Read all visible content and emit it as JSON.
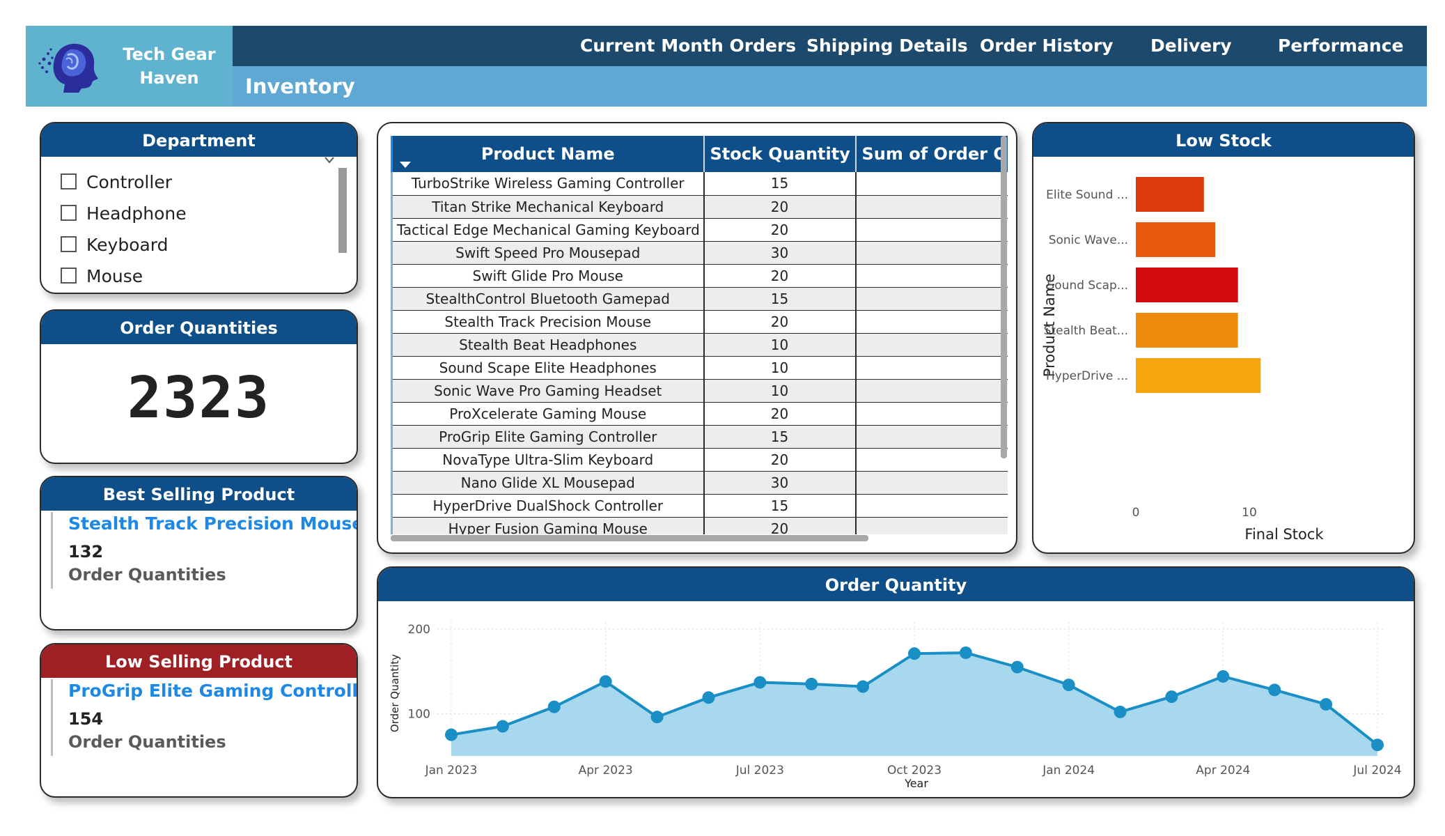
{
  "brand": {
    "name": "Tech Gear\nHaven",
    "logo_icon": "brain-head-icon"
  },
  "nav": {
    "items": [
      "Current Month Orders",
      "Shipping Details",
      "Order History",
      "Delivery",
      "Performance"
    ]
  },
  "page_title": "Inventory",
  "department": {
    "title": "Department",
    "items": [
      "Controller",
      "Headphone",
      "Keyboard",
      "Mouse"
    ]
  },
  "order_quantities": {
    "title": "Order Quantities",
    "value": "2323"
  },
  "best_selling": {
    "title": "Best Selling Product",
    "product": "Stealth Track Precision Mouse",
    "value": "132",
    "unit": "Order Quantities"
  },
  "low_selling": {
    "title": "Low Selling Product",
    "product": "ProGrip Elite Gaming Controller",
    "value": "154",
    "unit": "Order Quantities"
  },
  "inventory_table": {
    "columns": [
      "Product Name",
      "Stock Quantity",
      "Sum of Order Qu"
    ],
    "rows": [
      [
        "TurboStrike Wireless Gaming Controller",
        "15",
        ""
      ],
      [
        "Titan Strike Mechanical Keyboard",
        "20",
        ""
      ],
      [
        "Tactical Edge Mechanical Gaming Keyboard",
        "20",
        ""
      ],
      [
        "Swift Speed Pro Mousepad",
        "30",
        ""
      ],
      [
        "Swift Glide Pro Mouse",
        "20",
        ""
      ],
      [
        "StealthControl Bluetooth Gamepad",
        "15",
        ""
      ],
      [
        "Stealth Track Precision Mouse",
        "20",
        ""
      ],
      [
        "Stealth Beat Headphones",
        "10",
        ""
      ],
      [
        "Sound Scape Elite Headphones",
        "10",
        ""
      ],
      [
        "Sonic Wave Pro Gaming Headset",
        "10",
        ""
      ],
      [
        "ProXcelerate Gaming Mouse",
        "20",
        ""
      ],
      [
        "ProGrip Elite Gaming Controller",
        "15",
        ""
      ],
      [
        "NovaType Ultra-Slim Keyboard",
        "20",
        ""
      ],
      [
        "Nano Glide XL Mousepad",
        "30",
        ""
      ],
      [
        "HyperDrive DualShock Controller",
        "15",
        ""
      ],
      [
        "Hyper Fusion Gaming Mouse",
        "20",
        ""
      ]
    ]
  },
  "chart_data": [
    {
      "type": "bar",
      "orientation": "horizontal",
      "title": "Low Stock",
      "xlabel": "Final Stock",
      "ylabel": "Product Name",
      "categories": [
        "Elite Sound ...",
        "Sonic Wave...",
        "Sound Scap...",
        "Stealth Beat...",
        "HyperDrive ..."
      ],
      "values": [
        6,
        7,
        9,
        9,
        11
      ],
      "colors": [
        "#dc3a0a",
        "#e85a0c",
        "#d10b0b",
        "#ee8a0c",
        "#f7a50e"
      ],
      "xticks": [
        "0",
        "10"
      ],
      "xlim": [
        0,
        12
      ],
      "grid": false
    },
    {
      "type": "area",
      "title": "Order Quantity",
      "xlabel": "Year",
      "ylabel": "Order Quantity",
      "x": [
        "Jan 2023",
        "Feb 2023",
        "Mar 2023",
        "Apr 2023",
        "May 2023",
        "Jun 2023",
        "Jul 2023",
        "Aug 2023",
        "Sep 2023",
        "Oct 2023",
        "Nov 2023",
        "Dec 2023",
        "Jan 2024",
        "Feb 2024",
        "Mar 2024",
        "Apr 2024",
        "May 2024",
        "Jun 2024",
        "Jul 2024"
      ],
      "xticks": [
        "Jan 2023",
        "Apr 2023",
        "Jul 2023",
        "Oct 2023",
        "Jan 2024",
        "Apr 2024",
        "Jul 2024"
      ],
      "values": [
        75,
        85,
        108,
        138,
        96,
        119,
        137,
        135,
        132,
        171,
        172,
        155,
        134,
        102,
        120,
        144,
        128,
        111,
        63
      ],
      "yticks": [
        "100",
        "200"
      ],
      "ylim": [
        50,
        200
      ],
      "grid": true,
      "line_color": "#1a8fc6",
      "fill_color": "#a8d8ee"
    }
  ]
}
